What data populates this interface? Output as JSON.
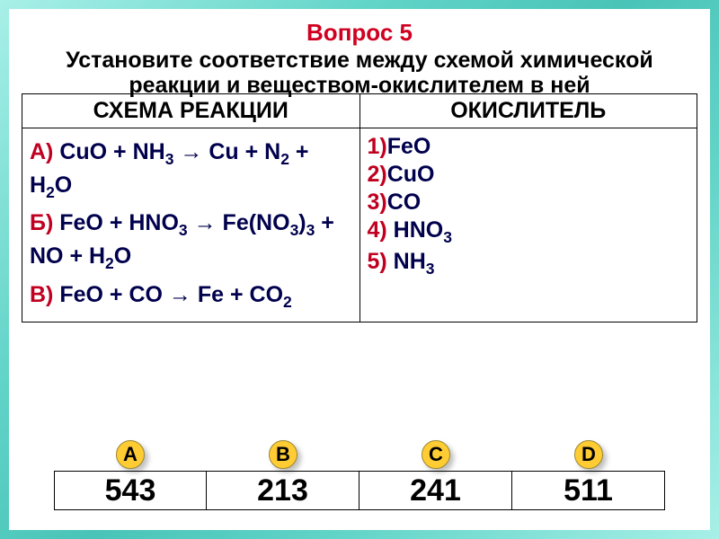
{
  "title": "Вопрос 5",
  "subtitle": "Установите соответствие между схемой химической реакции и веществом-окислителем в ней",
  "headers": {
    "left": "СХЕМА РЕАКЦИИ",
    "right": "ОКИСЛИТЕЛЬ"
  },
  "reactions": {
    "a": {
      "label": "А)",
      "text_html": "CuO + NH<sub>3</sub> → Cu + N<sub>2</sub> + H<sub>2</sub>O"
    },
    "b": {
      "label": "Б)",
      "text_html": "FeO + HNO<sub>3</sub> → Fe(NO<sub>3</sub>)<sub>3</sub> + NO + H<sub>2</sub>O"
    },
    "v": {
      "label": "В)",
      "text_html": "FeO + CO → Fe + CO<sub>2</sub>"
    }
  },
  "oxidizers": [
    {
      "num": "1)",
      "name": "FeO"
    },
    {
      "num": "2)",
      "name": "CuO"
    },
    {
      "num": "3)",
      "name": "CO"
    },
    {
      "num": "4)",
      "name_html": "HNO<sub>3</sub>"
    },
    {
      "num": "5)",
      "name_html": "NH<sub>3</sub>"
    }
  ],
  "answers": [
    {
      "letter": "A",
      "value": "543"
    },
    {
      "letter": "B",
      "value": "213"
    },
    {
      "letter": "C",
      "value": "241"
    },
    {
      "letter": "D",
      "value": "511"
    }
  ]
}
